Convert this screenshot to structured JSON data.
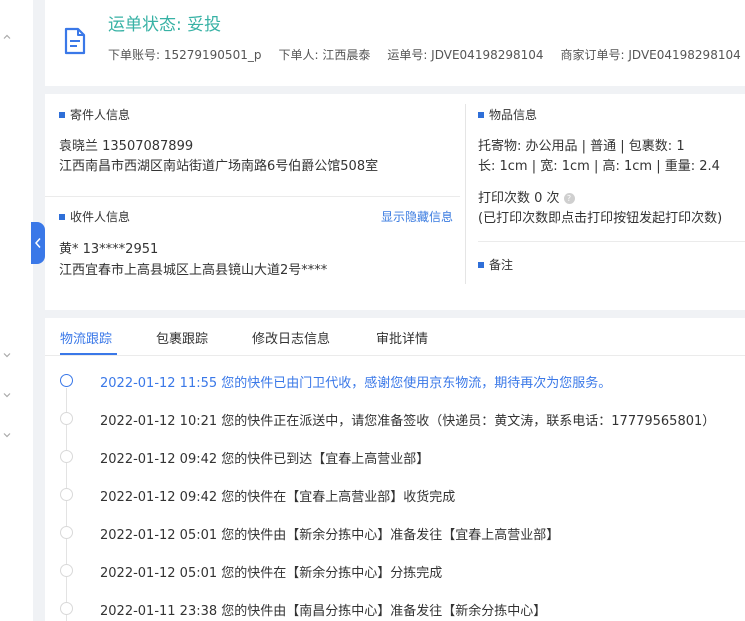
{
  "header": {
    "status_title": "运单状态: 妥投",
    "order_account": "下单账号: 15279190501_p",
    "orderer": "下单人: 江西晨泰",
    "waybill_no": "运单号: JDVE04198298104",
    "merchant_order_no": "商家订单号: JDVE04198298104"
  },
  "sender": {
    "section_title": "寄件人信息",
    "name_phone": "袁晓兰   13507087899",
    "address": "江西南昌市西湖区南站街道广场南路6号伯爵公馆508室"
  },
  "receiver": {
    "section_title": "收件人信息",
    "show_hidden_link": "显示隐藏信息",
    "name_phone": "黄*   13****2951",
    "address": "江西宜春市上高县城区上高县镜山大道2号****"
  },
  "goods": {
    "section_title": "物品信息",
    "line1": "托寄物:  办公用品 | 普通  |  包裹数:  1",
    "line2": "长:  1cm  |  宽:  1cm  |  高:  1cm  |  重量:  2.4",
    "print_count": "打印次数   0 次",
    "help_glyph": "?",
    "print_note": "(已打印次数即点击打印按钮发起打印次数)"
  },
  "remarks": {
    "section_title": "备注"
  },
  "tabs": [
    {
      "label": "物流跟踪"
    },
    {
      "label": "包裹跟踪"
    },
    {
      "label": "修改日志信息"
    },
    {
      "label": "审批详情"
    }
  ],
  "timeline": [
    {
      "text": "2022-01-12 11:55 您的快件已由门卫代收，感谢您使用京东物流，期待再次为您服务。"
    },
    {
      "text": "2022-01-12 10:21 您的快件正在派送中，请您准备签收（快递员：黄文涛，联系电话：17779565801）"
    },
    {
      "text": "2022-01-12 09:42 您的快件已到达【宜春上高营业部】"
    },
    {
      "text": "2022-01-12 09:42 您的快件在【宜春上高营业部】收货完成"
    },
    {
      "text": "2022-01-12 05:01 您的快件由【新余分拣中心】准备发往【宜春上高营业部】"
    },
    {
      "text": "2022-01-12 05:01 您的快件在【新余分拣中心】分拣完成"
    },
    {
      "text": "2022-01-11 23:38 您的快件由【南昌分拣中心】准备发往【新余分拣中心】"
    }
  ],
  "icons": {
    "document": "document-icon",
    "collapse": "chevron-left-icon"
  },
  "colors": {
    "status_green": "#38b2a5",
    "accent_blue": "#3a78e8"
  }
}
